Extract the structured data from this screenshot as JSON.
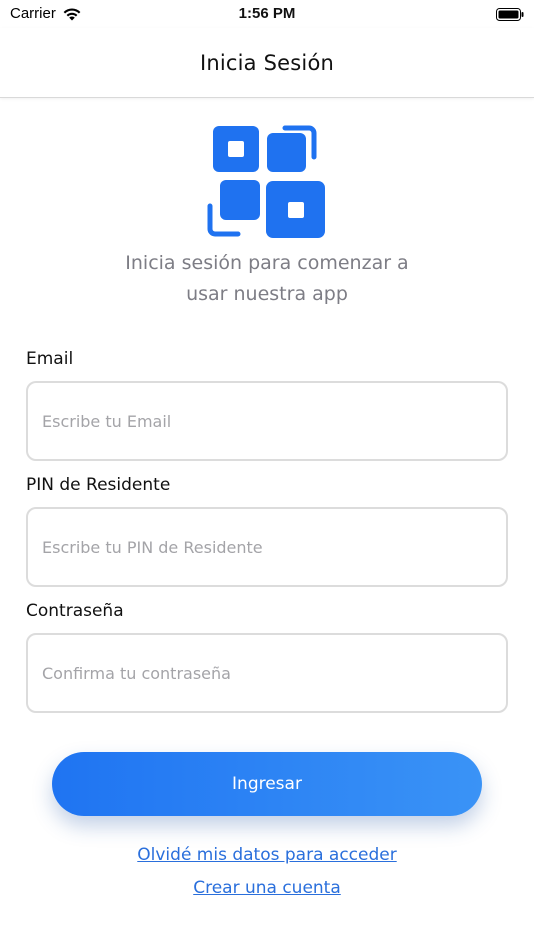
{
  "status_bar": {
    "carrier": "Carrier",
    "time": "1:56 PM"
  },
  "nav": {
    "title": "Inicia Sesión"
  },
  "header": {
    "logo_icon": "qr-squares-icon",
    "subtitle_line1": "Inicia sesión para comenzar a",
    "subtitle_line2": "usar nuestra app"
  },
  "form": {
    "email": {
      "label": "Email",
      "placeholder": "Escribe tu Email",
      "value": ""
    },
    "pin": {
      "label": "PIN de Residente",
      "placeholder": "Escribe tu PIN de Residente",
      "value": ""
    },
    "password": {
      "label": "Contraseña",
      "placeholder": "Confirma tu contraseña",
      "value": ""
    }
  },
  "actions": {
    "submit_label": "Ingresar",
    "forgot_link": "Olvidé mis datos para acceder",
    "create_link": "Crear una cuenta"
  },
  "colors": {
    "accent": "#1f74f2",
    "link": "#2a6fdc",
    "placeholder": "#a4a4a8"
  }
}
